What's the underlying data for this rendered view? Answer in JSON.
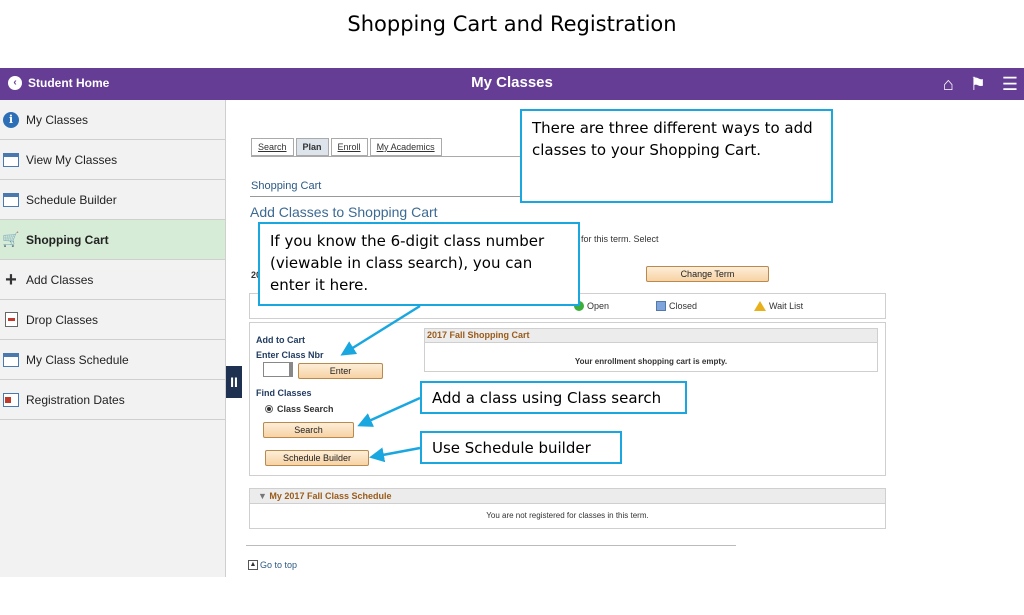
{
  "slide_title": "Shopping Cart and Registration",
  "topbar": {
    "back_label": "Student Home",
    "title": "My Classes",
    "icons": [
      "home-icon",
      "flag-icon",
      "menu-icon"
    ]
  },
  "sidebar": {
    "items": [
      {
        "label": "My Classes",
        "icon": "info-icon"
      },
      {
        "label": "View My Classes",
        "icon": "calendar-icon"
      },
      {
        "label": "Schedule Builder",
        "icon": "schedule-grid-icon"
      },
      {
        "label": "Shopping Cart",
        "icon": "cart-icon",
        "active": true
      },
      {
        "label": "Add Classes",
        "icon": "plus-icon"
      },
      {
        "label": "Drop Classes",
        "icon": "drop-doc-icon"
      },
      {
        "label": "My Class Schedule",
        "icon": "schedule-grid-icon"
      },
      {
        "label": "Registration Dates",
        "icon": "registration-icon"
      }
    ]
  },
  "tabs": [
    {
      "label": "Search"
    },
    {
      "label": "Plan",
      "selected": true
    },
    {
      "label": "Enroll"
    },
    {
      "label": "My Academics"
    }
  ],
  "content": {
    "breadcrumb": "Shopping Cart",
    "heading": "Add Classes to Shopping Cart",
    "instruction_fragment": "for this term.  Select",
    "term_prefix": "20",
    "change_term_label": "Change Term",
    "legend": {
      "open": "Open",
      "closed": "Closed",
      "wait": "Wait List"
    },
    "add_to_cart_label": "Add to Cart",
    "enter_class_nbr_label": "Enter Class Nbr",
    "enter_button": "Enter",
    "find_classes_label": "Find Classes",
    "class_search_radio": "Class Search",
    "search_button": "Search",
    "schedule_builder_button": "Schedule Builder",
    "cart_header": "2017 Fall Shopping Cart",
    "cart_empty": "Your enrollment shopping cart is empty.",
    "schedule_header": "My 2017 Fall Class Schedule",
    "schedule_empty": "You are not registered for classes in this term.",
    "go_to_top": "Go to top"
  },
  "callouts": {
    "three_ways": "There are three different ways to add classes to your Shopping Cart.",
    "class_number": "If you know the 6-digit class number (viewable in class search), you can enter it here.",
    "class_search": "Add a class using Class search",
    "schedule_builder": "Use Schedule builder"
  },
  "colors": {
    "topbar": "#663d94",
    "active_item": "#d7ecd6",
    "callout_border": "#1aa7e0",
    "section_header_text": "#9a5b1a"
  }
}
